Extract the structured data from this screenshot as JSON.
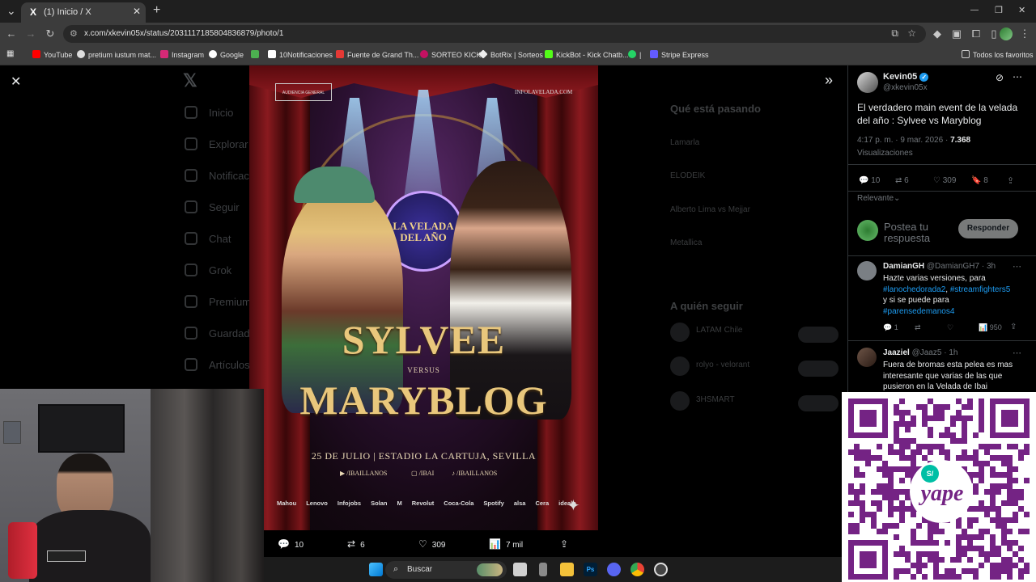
{
  "browser": {
    "tab_title": "(1) Inicio / X",
    "tab_favicon": "X",
    "tab_list_icon": "⌄",
    "new_tab_icon": "+",
    "close_tab_icon": "✕",
    "url": "x.com/xkevin05x/status/2031117185804836879/photo/1",
    "window_controls": {
      "minimize": "—",
      "restore": "❐",
      "close": "✕"
    },
    "bookmarks": [
      {
        "label": "YouTube",
        "color": "#ff0000"
      },
      {
        "label": "pretium iustum mat...",
        "color": "#dddddd"
      },
      {
        "label": "Instagram",
        "color": "#d62976"
      },
      {
        "label": "Google",
        "color": "#ffffff"
      },
      {
        "label": "",
        "color": "#4caf50"
      },
      {
        "label": "10Notificaciones",
        "color": "#ffffff"
      },
      {
        "label": "Fuente de Grand Th...",
        "color": "#e53935"
      },
      {
        "label": "SORTEO KICK",
        "color": "#c51162"
      },
      {
        "label": "BotRix | Sorteos",
        "color": "#eeeeee"
      },
      {
        "label": "KickBot - Kick Chatb...",
        "color": "#53fc18"
      },
      {
        "label": "|",
        "color": "#25d366"
      },
      {
        "label": "Stripe Express",
        "color": "#635bff"
      }
    ],
    "all_bookmarks": "Todos los favoritos"
  },
  "background_page": {
    "nav": [
      "Inicio",
      "Explorar",
      "Notificaciones",
      "Seguir",
      "Chat",
      "Grok",
      "Premium",
      "Guardados",
      "Artículos"
    ],
    "trending_header": "Qué está pasando",
    "trend_1": "Lamarla",
    "trend_2": "ELODEIK",
    "trend_3": "Alberto Lima vs Mejjar",
    "trend_4": "Metallica",
    "follow_header": "A quién seguir",
    "follow_1": "LATAM Chile",
    "follow_2": "rolyo - velorant",
    "follow_3": "3HSMART"
  },
  "poster": {
    "badge": "AUDIENCIA GENERAL",
    "site": "INFOLAVELADA.COM",
    "emblem": "LA VELADA DEL AÑO",
    "name_1": "SYLVEE",
    "versus": "VERSUS",
    "name_2": "MARYBLOG",
    "event": "25 DE JULIO | ESTADIO LA CARTUJA, SEVILLA",
    "social_1": "/IBAILLANOS",
    "social_2": "/IBAI",
    "social_3": "/IBAILLANOS",
    "sponsors": [
      "Mahou",
      "Lenovo",
      "Infojobs",
      "Solan",
      "M",
      "Revolut",
      "Coca-Cola",
      "Spotify",
      "alsa",
      "Cera",
      "idealo"
    ]
  },
  "media_bar": {
    "replies": "10",
    "reposts": "6",
    "likes": "309",
    "views": "7 mil"
  },
  "tweet": {
    "author": "Kevin05",
    "handle": "@xkevin05x",
    "text": "El verdadero main event de la velada del año : Sylvee vs Maryblog",
    "meta": "4:17 p. m. · 9 mar. 2026 ·",
    "views_count": "7.368",
    "views_label": "Visualizaciones",
    "replies": "10",
    "reposts": "6",
    "likes": "309",
    "bookmarks": "8",
    "sort_label": "Relevante",
    "reply_placeholder": "Postea tu respuesta",
    "reply_button": "Responder"
  },
  "replies": [
    {
      "name": "DamianGH",
      "handle": "@DamianGH7 · 3h",
      "text_a": "Hazte varias versiones, para",
      "hashtag_1": "#lanochedorada2",
      "sep": ",",
      "hashtag_2": "#streamfighters5",
      "text_b": "y si se puede para",
      "hashtag_3": "#parensedemanos4",
      "stat_replies": "1",
      "stat_views": "950"
    },
    {
      "name": "Jaaziel",
      "handle": "@Jaaz5 · 1h",
      "text": "Fuera de bromas esta pelea es mas interesante que varias de las que pusieron en la Velada de Ibai"
    }
  ],
  "qr": {
    "brand": "yape",
    "symbol": "S/"
  },
  "taskbar": {
    "search": "Buscar"
  },
  "colors": {
    "x_blue": "#1d9bf0",
    "poster_gold": "#e9c77c",
    "yape_purple": "#742384"
  }
}
